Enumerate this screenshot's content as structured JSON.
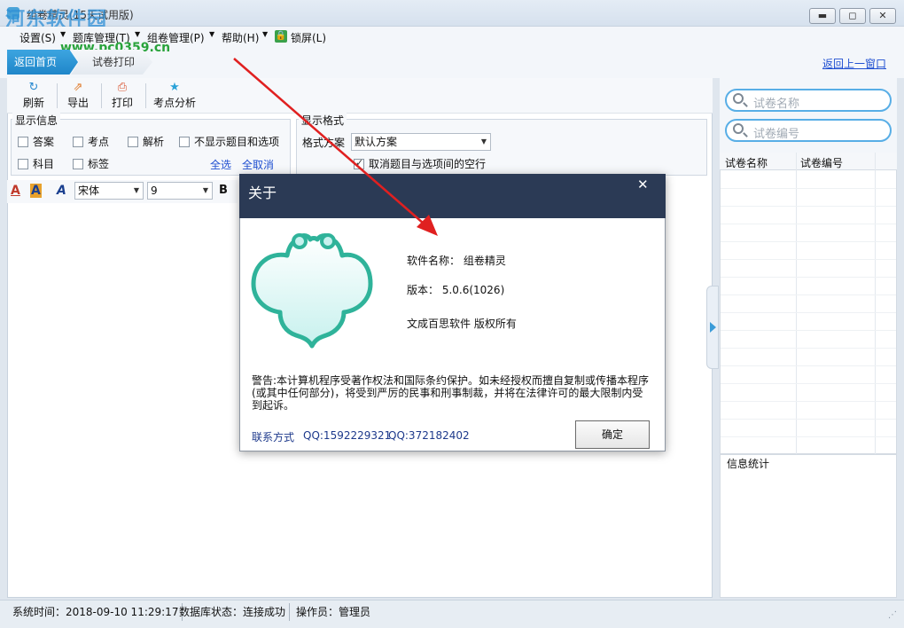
{
  "window": {
    "title": "组卷精灵(15天试用版)",
    "minimize": "▬",
    "restore": "◻",
    "close": "✕"
  },
  "watermark": {
    "brand": "河东软件园",
    "url": "www.pc0359.cn"
  },
  "menu": {
    "settings": "设置(S)",
    "questions": "题库管理(T)",
    "papers": "组卷管理(P)",
    "help": "帮助(H)",
    "lock": "锁屏(L)"
  },
  "nav": {
    "home": "返回首页",
    "print": "试卷打印",
    "back": "返回上一窗口"
  },
  "toolbar": {
    "refresh": "刷新",
    "export": "导出",
    "print": "打印",
    "analysis": "考点分析"
  },
  "display_info": {
    "legend": "显示信息",
    "answer": "答案",
    "point": "考点",
    "analysis": "解析",
    "hide": "不显示题目和选项",
    "subject": "科目",
    "tag": "标签",
    "select_all": "全选",
    "deselect_all": "全取消"
  },
  "display_format": {
    "legend": "显示格式",
    "scheme_label": "格式方案",
    "scheme_value": "默认方案",
    "remove_blank": "取消题目与选项间的空行",
    "remove_blank_checked": true
  },
  "format_bar": {
    "font": "宋体",
    "size": "9",
    "bold": "B"
  },
  "search": {
    "name_placeholder": "试卷名称",
    "code_placeholder": "试卷编号"
  },
  "grid": {
    "col_name": "试卷名称",
    "col_code": "试卷编号"
  },
  "info": {
    "label": "信息统计"
  },
  "status": {
    "time": "系统时间：2018-09-10 11:29:17",
    "db": "数据库状态：连接成功",
    "operator": "操作员：管理员"
  },
  "dialog": {
    "title": "关于",
    "close": "✕",
    "software_name": "软件名称：  组卷精灵",
    "version": "版本：  5.0.6(1026)",
    "copyright": "文成百思软件  版权所有",
    "warning": "警告:本计算机程序受著作权法和国际条约保护。如未经授权而擅自复制或传播本程序(或其中任何部分)，将受到严厉的民事和刑事制裁，并将在法律许可的最大限制内受到起诉。",
    "contact_label": "联系方式",
    "qq1": "QQ:1592229321",
    "qq2": "QQ:372182402",
    "ok": "确定"
  },
  "colors": {
    "accent": "#1f86c9",
    "dialog_header": "#2b3a55",
    "mascot": "#2fb39a",
    "arrow": "#e02020"
  }
}
